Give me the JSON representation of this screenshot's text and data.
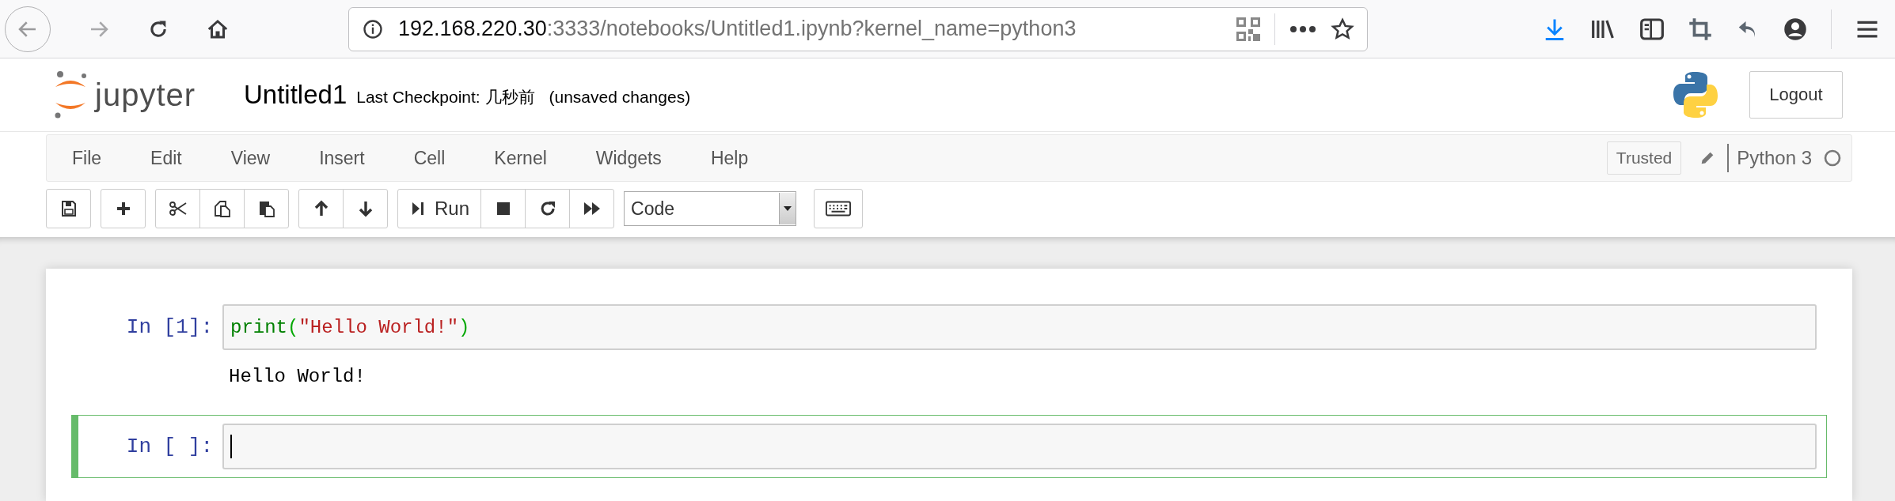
{
  "browser": {
    "url": {
      "host": "192.168.220.30",
      "path": ":3333/notebooks/Untitled1.ipynb?kernel_name=python3"
    }
  },
  "header": {
    "logo_text": "jupyter",
    "notebook_name": "Untitled1",
    "checkpoint": "Last Checkpoint: 几秒前",
    "unsaved": "(unsaved changes)",
    "logout": "Logout"
  },
  "menu": {
    "items": [
      "File",
      "Edit",
      "View",
      "Insert",
      "Cell",
      "Kernel",
      "Widgets",
      "Help"
    ],
    "trusted": "Trusted",
    "kernel_name": "Python 3",
    "kernel_idle": true
  },
  "toolbar": {
    "groups": [
      [
        {
          "kind": "save"
        }
      ],
      [
        {
          "kind": "plus"
        }
      ],
      [
        {
          "kind": "cut"
        },
        {
          "kind": "copy"
        },
        {
          "kind": "paste"
        }
      ],
      [
        {
          "kind": "up"
        },
        {
          "kind": "down"
        }
      ],
      [
        {
          "kind": "run",
          "label": "Run"
        },
        {
          "kind": "stop"
        },
        {
          "kind": "restart"
        },
        {
          "kind": "fastforward"
        }
      ]
    ],
    "cell_type": "Code"
  },
  "cells": [
    {
      "prompt": "In [1]:",
      "selected": false,
      "input": [
        {
          "kind": "builtin",
          "text": "print"
        },
        {
          "kind": "paren",
          "text": "("
        },
        {
          "kind": "string",
          "text": "\"Hello World!\""
        },
        {
          "kind": "paren",
          "text": ")"
        }
      ],
      "output": "Hello World!"
    },
    {
      "prompt": "In [ ]:",
      "selected": true
    }
  ]
}
